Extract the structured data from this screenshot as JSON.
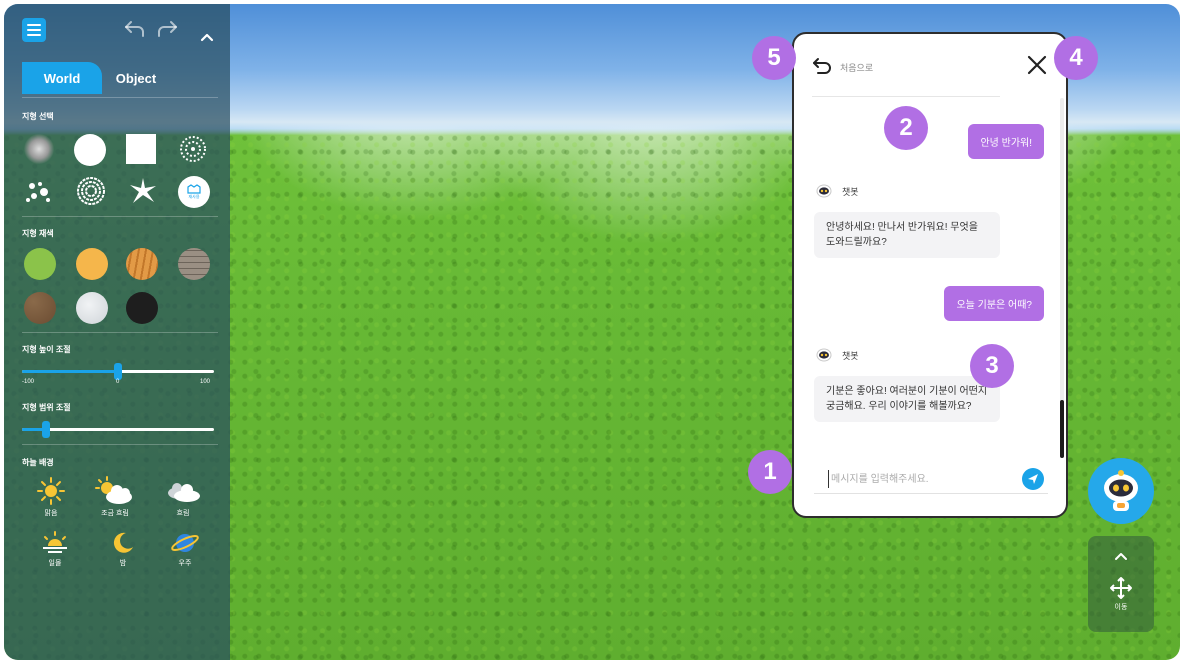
{
  "panel": {
    "tabs": {
      "world": "World",
      "object": "Object"
    },
    "sections": {
      "terrain_shape": "지형 선택",
      "terrain_texture": "지형 재색",
      "terrain_height": "지형 높이 조절",
      "terrain_range": "지형 범위 조절",
      "sky": "하늘 배경"
    },
    "shape_custom_label": "재사용",
    "height_slider": {
      "min_label": "-100",
      "mid_label": "0",
      "max_label": "100",
      "value": 0
    },
    "range_slider": {
      "value": 0.12
    },
    "texture_colors": [
      "#8bc34a",
      "#f5b64b",
      "#e29a46",
      "#9a8f83",
      "#7a5a3e",
      "#dfe3e6",
      "#1e1e1e"
    ],
    "sky_options": [
      {
        "label": "맑음",
        "icon": "sun-icon"
      },
      {
        "label": "조금 흐림",
        "icon": "partly-cloudy-icon"
      },
      {
        "label": "흐림",
        "icon": "cloudy-icon"
      },
      {
        "label": "일몰",
        "icon": "sunset-icon"
      },
      {
        "label": "밤",
        "icon": "moon-icon"
      },
      {
        "label": "우주",
        "icon": "planet-icon"
      }
    ]
  },
  "chat": {
    "back_label": "처음으로",
    "bot_name": "챗봇",
    "messages": [
      {
        "from": "user",
        "text": "안녕 반가워!"
      },
      {
        "from": "bot",
        "text": "안녕하세요! 만나서 반가워요! 무엇을 도와드릴까요?"
      },
      {
        "from": "user",
        "text": "오늘 기분은 어때?"
      },
      {
        "from": "bot",
        "text": "기분은 좋아요! 여러분이 기분이 어떤지 궁금해요. 우리 이야기를 해볼까요?"
      }
    ],
    "input_placeholder": "메시지를 입력해주세요.",
    "input_value": ""
  },
  "markers": [
    "1",
    "2",
    "3",
    "4",
    "5"
  ],
  "move_control": {
    "label": "이동"
  },
  "colors": {
    "accent": "#1aa3e8",
    "marker": "#b16fe4",
    "user_bubble": "#b16fe4"
  }
}
